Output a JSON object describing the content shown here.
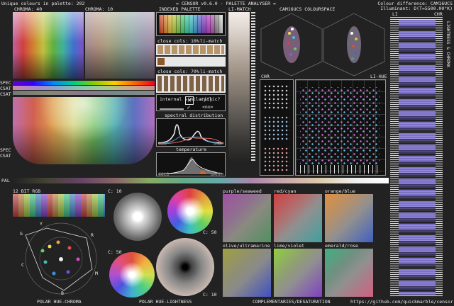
{
  "header": {
    "unique_colours": "Unique colours in palette: 202",
    "title": "= CENSOR v0.6.0 - PALETTE ANALYSER =",
    "colour_difference": "Colour difference: CAM16UCS",
    "illuminant": "Illuminant: D(T=5500.00°K)"
  },
  "labels": {
    "chroma_40": "CHROMA: 40",
    "chroma_10": "CHROMA: 10",
    "indexed_palette": "INDEXED PALETTE",
    "li_match": "LI-MATCH",
    "cam16ucs_colourspace": "CAM16UCS COLOURSPACE",
    "chr": "CHR",
    "li_hue": "LI-HUE",
    "li": "LI",
    "chr_right": "CHR",
    "lightness_chroma": "LIGHTNESS & CHROMA",
    "close_cols_10": "close cols: 10%",
    "li_match_10": "li-match",
    "close_cols_70": "close cols: 70%",
    "li_match_70": "li-match",
    "internal_similarity": "internal similarity",
    "cyclic": "cyclic?",
    "cyclic_value": "<no>",
    "spectral_distribution": "spectral distribution",
    "range_low": "380",
    "range_high": "650",
    "temperature": "temperature",
    "cold": "COLD",
    "warm": "WARM",
    "spec1": "SPEC",
    "spec2": "CSAT",
    "spec3": "CSAT",
    "spec4": "SPEC",
    "spec5": "CSAT",
    "pal": "PAL",
    "rgb12": "12 BIT RGB",
    "c10a": "C: 10",
    "c50a": "C: 50",
    "c50b": "C: 50",
    "c10b": "C: 10",
    "purple_seaweed": "purple/seaweed",
    "red_cyan": "red/cyan",
    "orange_blue": "orange/blue",
    "olive_ultramarine": "olive/ultramarine",
    "lime_violet": "lime/violet",
    "emerald_rose": "emerald/rose",
    "polar_hue_chroma": "POLAR HUE-CHROMA",
    "polar_hue_lightness": "POLAR HUE-LIGHTNESS",
    "complementaries": "COMPLEMENTARIES/DESATURATION",
    "url": "https://github.com/quickmarble/censor",
    "hue_letters": {
      "g": "G",
      "y": "Y",
      "r": "R",
      "c": "C",
      "m": "M",
      "b": "B"
    }
  },
  "colors": {
    "background": "#222222",
    "panel": "#111111",
    "frame": "#9a9a9a",
    "text": "#e8e8e8",
    "accent_violet": "#7a6fd0"
  }
}
